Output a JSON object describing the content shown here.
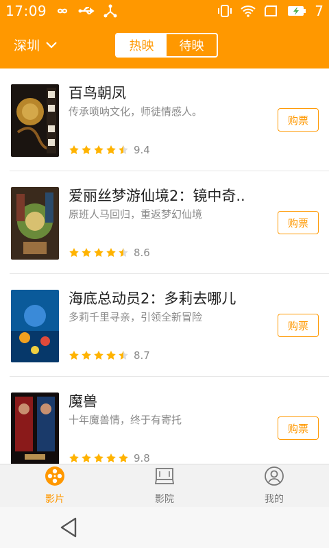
{
  "status_bar": {
    "time": "17:09",
    "battery_level": "7",
    "icons": [
      "infinity-icon",
      "usb-icon",
      "share-icon",
      "vibrate-icon",
      "wifi-icon",
      "sim-icon",
      "battery-charging-icon"
    ]
  },
  "header": {
    "city": "深圳",
    "tabs": [
      {
        "label": "热映",
        "active": true
      },
      {
        "label": "待映",
        "active": false
      }
    ]
  },
  "colors": {
    "accent": "#FF9800",
    "star": "#FFB300"
  },
  "movies": [
    {
      "title": "百鸟朝凤",
      "desc": "传承唢呐文化，师徒情感人。",
      "score": "9.4",
      "stars": 4.5,
      "buy_label": "购票"
    },
    {
      "title": "爱丽丝梦游仙境2：镜中奇..",
      "desc": "原班人马回归，重返梦幻仙境",
      "score": "8.6",
      "stars": 4.5,
      "buy_label": "购票"
    },
    {
      "title": "海底总动员2：多莉去哪儿",
      "desc": "多莉千里寻亲，引领全新冒险",
      "score": "8.7",
      "stars": 4.5,
      "buy_label": "购票"
    },
    {
      "title": "魔兽",
      "desc": "十年魔兽情，终于有寄托",
      "score": "9.8",
      "stars": 5,
      "buy_label": "购票"
    }
  ],
  "tabbar": {
    "items": [
      {
        "label": "影片",
        "icon": "film-reel-icon",
        "active": true
      },
      {
        "label": "影院",
        "icon": "cinema-screen-icon",
        "active": false
      },
      {
        "label": "我的",
        "icon": "user-profile-icon",
        "active": false
      }
    ]
  }
}
